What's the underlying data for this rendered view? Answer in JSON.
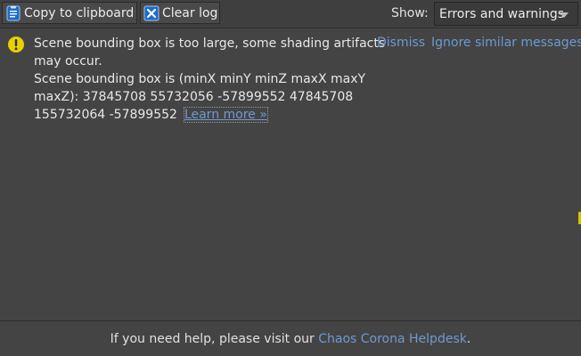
{
  "toolbar": {
    "copy_label": "Copy to clipboard",
    "clear_label": "Clear log",
    "show_label": "Show:",
    "filter_value": "Errors and warnings",
    "copy_icon": "clipboard-icon",
    "clear_icon": "clear-log-icon"
  },
  "message": {
    "severity": "warning",
    "line1": "Scene bounding box is too large, some shading artifacts",
    "line2": "may occur.",
    "line3": "Scene bounding box is (minX minY minZ maxX maxY",
    "line4": "maxZ): 37845708 55732056 -57899552 47845708",
    "line5": "155732064 -57899552",
    "learn_more": "Learn more »",
    "dismiss": "Dismiss",
    "ignore": "Ignore similar messages"
  },
  "footer": {
    "prefix": "If you need help, please visit our ",
    "link": "Chaos Corona Helpdesk",
    "suffix": "."
  },
  "colors": {
    "background": "#444444",
    "link": "#6d9ad1",
    "warning": "#e8d000",
    "icon_blue": "#2f7fd8"
  }
}
